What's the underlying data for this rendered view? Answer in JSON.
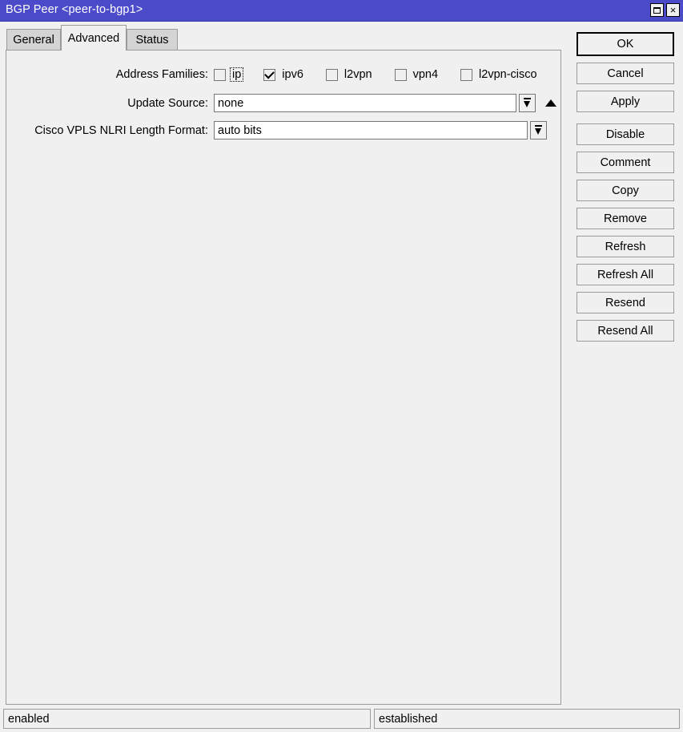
{
  "window": {
    "title": "BGP Peer <peer-to-bgp1>",
    "controls": {
      "maximize": "maximize-restore",
      "close": "×"
    }
  },
  "tabs": [
    {
      "label": "General",
      "selected": false
    },
    {
      "label": "Advanced",
      "selected": true
    },
    {
      "label": "Status",
      "selected": false
    }
  ],
  "form": {
    "address_families": {
      "label": "Address Families:",
      "options": [
        {
          "label": "ip",
          "checked": false,
          "focused": true
        },
        {
          "label": "ipv6",
          "checked": true,
          "focused": false
        },
        {
          "label": "l2vpn",
          "checked": false,
          "focused": false
        },
        {
          "label": "vpn4",
          "checked": false,
          "focused": false
        },
        {
          "label": "l2vpn-cisco",
          "checked": false,
          "focused": false
        }
      ]
    },
    "update_source": {
      "label": "Update Source:",
      "value": "none",
      "dropdown_icon": "dropdown-arrow-icon",
      "collapse_icon": "up-triangle-icon"
    },
    "cisco_vpls_nlri": {
      "label": "Cisco VPLS NLRI Length Format:",
      "value": "auto bits",
      "dropdown_icon": "dropdown-arrow-icon"
    }
  },
  "buttons": [
    {
      "label": "OK",
      "primary": true
    },
    {
      "label": "Cancel",
      "primary": false
    },
    {
      "label": "Apply",
      "primary": false
    },
    {
      "label": "Disable",
      "primary": false
    },
    {
      "label": "Comment",
      "primary": false
    },
    {
      "label": "Copy",
      "primary": false
    },
    {
      "label": "Remove",
      "primary": false
    },
    {
      "label": "Refresh",
      "primary": false
    },
    {
      "label": "Refresh All",
      "primary": false
    },
    {
      "label": "Resend",
      "primary": false
    },
    {
      "label": "Resend All",
      "primary": false
    }
  ],
  "statusbar": {
    "enabled": "enabled",
    "state": "established"
  },
  "colors": {
    "titlebar": "#4b4bc9",
    "titlebar_text": "#ffffff",
    "surface": "#f0f0f0",
    "tab_inactive": "#d4d4d4",
    "border": "#9a9a9a",
    "field_bg": "#ffffff"
  }
}
